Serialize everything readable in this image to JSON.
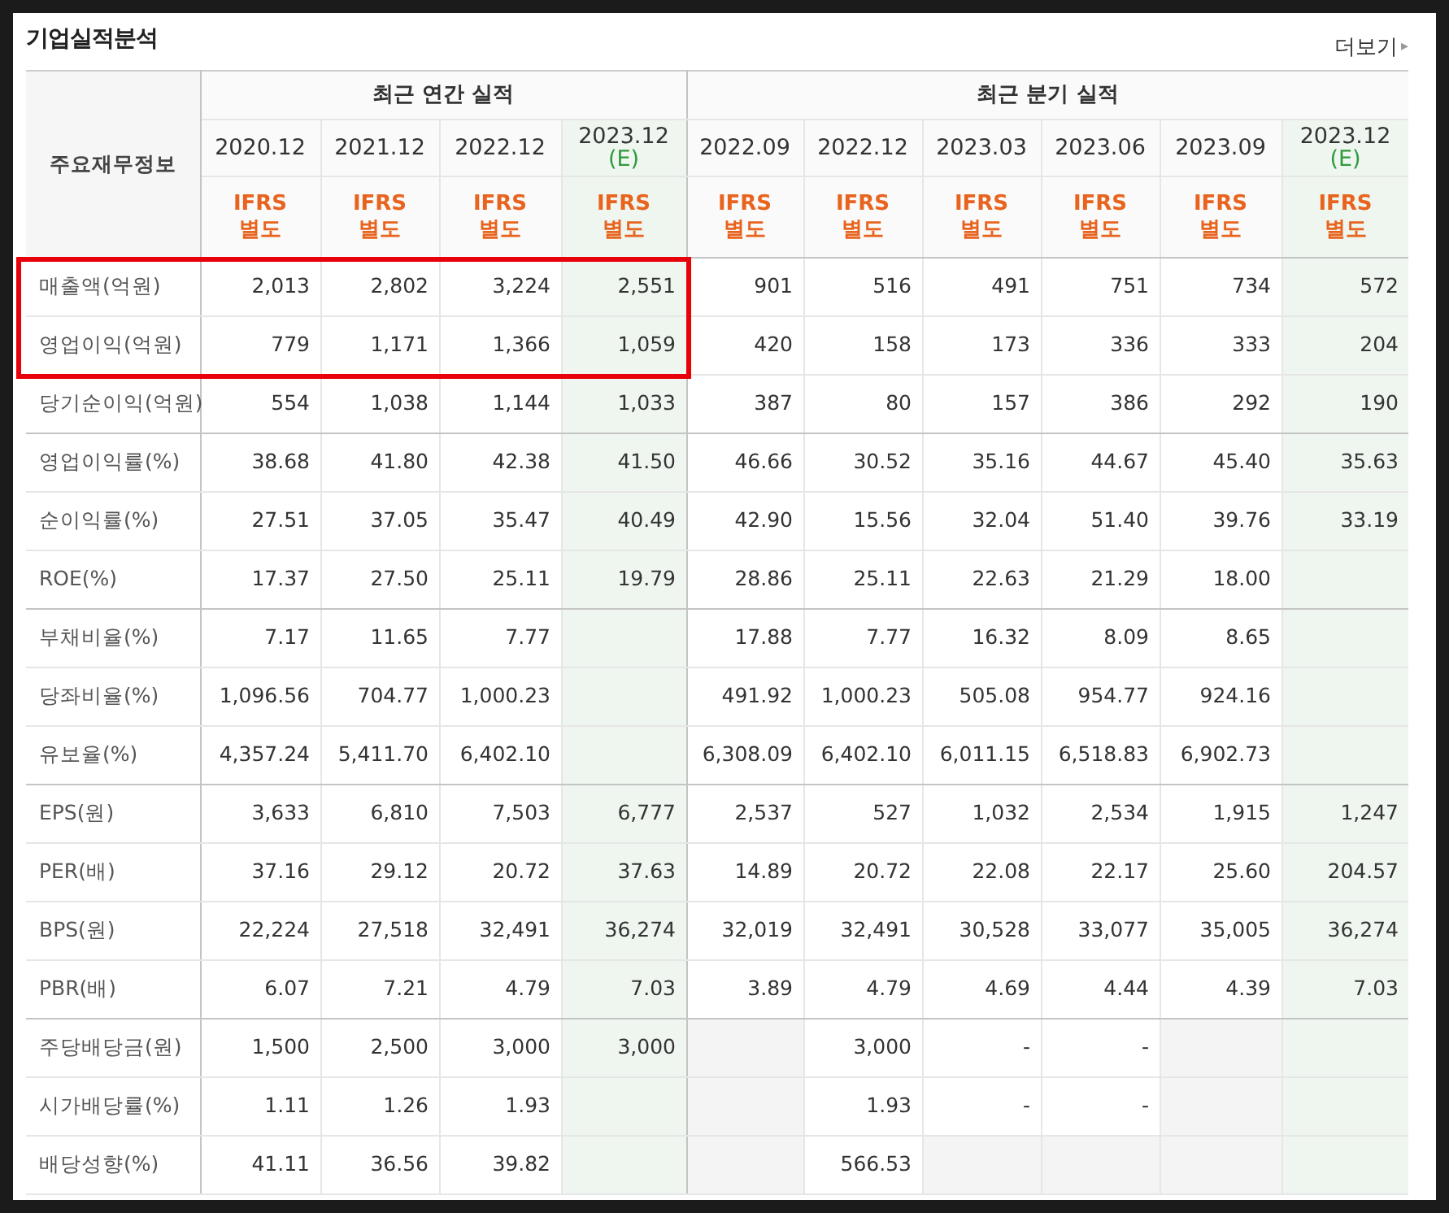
{
  "title": "기업실적분석",
  "more_link": {
    "label": "더보기",
    "arrow": "▸"
  },
  "row_header": "주요재무정보",
  "sections": [
    {
      "label": "최근 연간 실적",
      "columns": [
        {
          "period": "2020.12",
          "standard": "IFRS",
          "basis": "별도",
          "kind": "actual"
        },
        {
          "period": "2021.12",
          "standard": "IFRS",
          "basis": "별도",
          "kind": "actual"
        },
        {
          "period": "2022.12",
          "standard": "IFRS",
          "basis": "별도",
          "kind": "actual"
        },
        {
          "period": "2023.12",
          "estimate_mark": "(E)",
          "standard": "IFRS",
          "basis": "별도",
          "kind": "estimate"
        }
      ]
    },
    {
      "label": "최근 분기 실적",
      "columns": [
        {
          "period": "2022.09",
          "standard": "IFRS",
          "basis": "별도",
          "kind": "actual"
        },
        {
          "period": "2022.12",
          "standard": "IFRS",
          "basis": "별도",
          "kind": "actual"
        },
        {
          "period": "2023.03",
          "standard": "IFRS",
          "basis": "별도",
          "kind": "actual"
        },
        {
          "period": "2023.06",
          "standard": "IFRS",
          "basis": "별도",
          "kind": "actual"
        },
        {
          "period": "2023.09",
          "standard": "IFRS",
          "basis": "별도",
          "kind": "actual"
        },
        {
          "period": "2023.12",
          "estimate_mark": "(E)",
          "standard": "IFRS",
          "basis": "별도",
          "kind": "estimate"
        }
      ]
    }
  ],
  "rows": [
    {
      "label": "매출액(억원)",
      "highlighted": true,
      "group_end": false,
      "cells": [
        {
          "text": "2,013"
        },
        {
          "text": "2,802"
        },
        {
          "text": "3,224"
        },
        {
          "text": "2,551"
        },
        {
          "text": "901"
        },
        {
          "text": "516"
        },
        {
          "text": "491"
        },
        {
          "text": "751"
        },
        {
          "text": "734"
        },
        {
          "text": "572"
        }
      ]
    },
    {
      "label": "영업이익(억원)",
      "highlighted": true,
      "group_end": false,
      "cells": [
        {
          "text": "779"
        },
        {
          "text": "1,171"
        },
        {
          "text": "1,366"
        },
        {
          "text": "1,059"
        },
        {
          "text": "420"
        },
        {
          "text": "158"
        },
        {
          "text": "173"
        },
        {
          "text": "336"
        },
        {
          "text": "333"
        },
        {
          "text": "204"
        }
      ]
    },
    {
      "label": "당기순이익(억원)",
      "highlighted": false,
      "group_end": true,
      "cells": [
        {
          "text": "554"
        },
        {
          "text": "1,038"
        },
        {
          "text": "1,144"
        },
        {
          "text": "1,033"
        },
        {
          "text": "387"
        },
        {
          "text": "80"
        },
        {
          "text": "157"
        },
        {
          "text": "386"
        },
        {
          "text": "292"
        },
        {
          "text": "190"
        }
      ]
    },
    {
      "label": "영업이익률(%)",
      "highlighted": false,
      "group_end": false,
      "cells": [
        {
          "text": "38.68"
        },
        {
          "text": "41.80"
        },
        {
          "text": "42.38"
        },
        {
          "text": "41.50"
        },
        {
          "text": "46.66"
        },
        {
          "text": "30.52"
        },
        {
          "text": "35.16"
        },
        {
          "text": "44.67"
        },
        {
          "text": "45.40"
        },
        {
          "text": "35.63"
        }
      ]
    },
    {
      "label": "순이익률(%)",
      "highlighted": false,
      "group_end": false,
      "cells": [
        {
          "text": "27.51"
        },
        {
          "text": "37.05"
        },
        {
          "text": "35.47"
        },
        {
          "text": "40.49"
        },
        {
          "text": "42.90"
        },
        {
          "text": "15.56"
        },
        {
          "text": "32.04"
        },
        {
          "text": "51.40"
        },
        {
          "text": "39.76"
        },
        {
          "text": "33.19"
        }
      ]
    },
    {
      "label": "ROE(%)",
      "highlighted": false,
      "group_end": true,
      "cells": [
        {
          "text": "17.37"
        },
        {
          "text": "27.50"
        },
        {
          "text": "25.11"
        },
        {
          "text": "19.79"
        },
        {
          "text": "28.86"
        },
        {
          "text": "25.11"
        },
        {
          "text": "22.63"
        },
        {
          "text": "21.29"
        },
        {
          "text": "18.00"
        },
        {
          "empty": true
        }
      ]
    },
    {
      "label": "부채비율(%)",
      "highlighted": false,
      "group_end": false,
      "cells": [
        {
          "text": "7.17"
        },
        {
          "text": "11.65"
        },
        {
          "text": "7.77"
        },
        {
          "empty": true
        },
        {
          "text": "17.88"
        },
        {
          "text": "7.77"
        },
        {
          "text": "16.32"
        },
        {
          "text": "8.09"
        },
        {
          "text": "8.65"
        },
        {
          "empty": true
        }
      ]
    },
    {
      "label": "당좌비율(%)",
      "highlighted": false,
      "group_end": false,
      "cells": [
        {
          "text": "1,096.56"
        },
        {
          "text": "704.77"
        },
        {
          "text": "1,000.23"
        },
        {
          "empty": true
        },
        {
          "text": "491.92"
        },
        {
          "text": "1,000.23"
        },
        {
          "text": "505.08"
        },
        {
          "text": "954.77"
        },
        {
          "text": "924.16"
        },
        {
          "empty": true
        }
      ]
    },
    {
      "label": "유보율(%)",
      "highlighted": false,
      "group_end": true,
      "cells": [
        {
          "text": "4,357.24"
        },
        {
          "text": "5,411.70"
        },
        {
          "text": "6,402.10"
        },
        {
          "empty": true
        },
        {
          "text": "6,308.09"
        },
        {
          "text": "6,402.10"
        },
        {
          "text": "6,011.15"
        },
        {
          "text": "6,518.83"
        },
        {
          "text": "6,902.73"
        },
        {
          "empty": true
        }
      ]
    },
    {
      "label": "EPS(원)",
      "highlighted": false,
      "group_end": false,
      "cells": [
        {
          "text": "3,633"
        },
        {
          "text": "6,810"
        },
        {
          "text": "7,503"
        },
        {
          "text": "6,777"
        },
        {
          "text": "2,537"
        },
        {
          "text": "527"
        },
        {
          "text": "1,032"
        },
        {
          "text": "2,534"
        },
        {
          "text": "1,915"
        },
        {
          "text": "1,247"
        }
      ]
    },
    {
      "label": "PER(배)",
      "highlighted": false,
      "group_end": false,
      "cells": [
        {
          "text": "37.16"
        },
        {
          "text": "29.12"
        },
        {
          "text": "20.72"
        },
        {
          "text": "37.63"
        },
        {
          "text": "14.89"
        },
        {
          "text": "20.72"
        },
        {
          "text": "22.08"
        },
        {
          "text": "22.17"
        },
        {
          "text": "25.60"
        },
        {
          "text": "204.57"
        }
      ]
    },
    {
      "label": "BPS(원)",
      "highlighted": false,
      "group_end": false,
      "cells": [
        {
          "text": "22,224"
        },
        {
          "text": "27,518"
        },
        {
          "text": "32,491"
        },
        {
          "text": "36,274"
        },
        {
          "text": "32,019"
        },
        {
          "text": "32,491"
        },
        {
          "text": "30,528"
        },
        {
          "text": "33,077"
        },
        {
          "text": "35,005"
        },
        {
          "text": "36,274"
        }
      ]
    },
    {
      "label": "PBR(배)",
      "highlighted": false,
      "group_end": true,
      "cells": [
        {
          "text": "6.07"
        },
        {
          "text": "7.21"
        },
        {
          "text": "4.79"
        },
        {
          "text": "7.03"
        },
        {
          "text": "3.89"
        },
        {
          "text": "4.79"
        },
        {
          "text": "4.69"
        },
        {
          "text": "4.44"
        },
        {
          "text": "4.39"
        },
        {
          "text": "7.03"
        }
      ]
    },
    {
      "label": "주당배당금(원)",
      "highlighted": false,
      "group_end": false,
      "cells": [
        {
          "text": "1,500"
        },
        {
          "text": "2,500"
        },
        {
          "text": "3,000"
        },
        {
          "text": "3,000"
        },
        {
          "empty": true
        },
        {
          "text": "3,000"
        },
        {
          "text": "-"
        },
        {
          "text": "-"
        },
        {
          "empty": true
        },
        {
          "empty": true
        }
      ]
    },
    {
      "label": "시가배당률(%)",
      "highlighted": false,
      "group_end": false,
      "cells": [
        {
          "text": "1.11"
        },
        {
          "text": "1.26"
        },
        {
          "text": "1.93"
        },
        {
          "empty": true
        },
        {
          "empty": true
        },
        {
          "text": "1.93"
        },
        {
          "text": "-"
        },
        {
          "text": "-"
        },
        {
          "empty": true
        },
        {
          "empty": true
        }
      ]
    },
    {
      "label": "배당성향(%)",
      "highlighted": false,
      "group_end": false,
      "cells": [
        {
          "text": "41.11"
        },
        {
          "text": "36.56"
        },
        {
          "text": "39.82"
        },
        {
          "empty": true
        },
        {
          "empty": true
        },
        {
          "text": "566.53"
        },
        {
          "empty": true
        },
        {
          "empty": true
        },
        {
          "empty": true
        },
        {
          "empty": true
        }
      ]
    }
  ]
}
